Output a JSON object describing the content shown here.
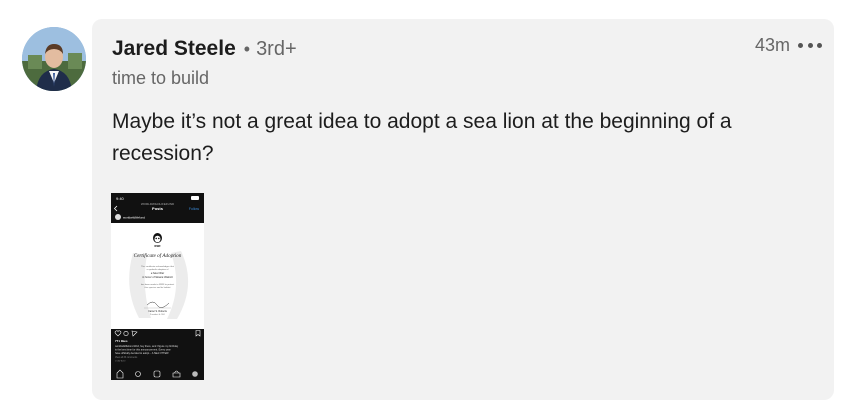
{
  "author": {
    "name": "Jared Steele",
    "separator": "•",
    "degree": "3rd+",
    "headline": "time to build"
  },
  "meta": {
    "timestamp": "43m",
    "more_icon": "more-horizontal-icon"
  },
  "comment": {
    "text": "Maybe it’s not a great idea to adopt a sea lion at the beginning of a recession?"
  },
  "attachment": {
    "status_time": "9:40",
    "profile_small": "WORLDWILDLIFEFUND",
    "screen_title": "Posts",
    "follow_label": "Follow",
    "account_name": "worldwildlifefund",
    "logo_text": "WWF",
    "certificate_title": "Certificate of Adoption",
    "cert_line_1": "This certificate acknowledges that",
    "cert_line_2": "a symbolic adoption of",
    "cert_line_3": "a Sea Otter",
    "cert_line_4": "in honor of Sloane Walcott",
    "cert_line_5": "has been made to WWF to protect",
    "cert_line_6": "this species and its habitat",
    "signer_name": "Carter S. Roberts",
    "signer_title": "President & CEO",
    "likes": "771 likes",
    "caption_1": "worldwildlifefund Well, hey there, and I figure my birthday",
    "caption_2": "is the best time for this announcement. Every year",
    "caption_3": "have officially decided to adopt... A SEA OTTER!",
    "view_comments": "View all 33 comments",
    "ago": "1 DAY AGO",
    "colors": {
      "phone_bg": "#111111",
      "page_bg": "#ffffff",
      "accent": "#3b8bd9"
    }
  }
}
